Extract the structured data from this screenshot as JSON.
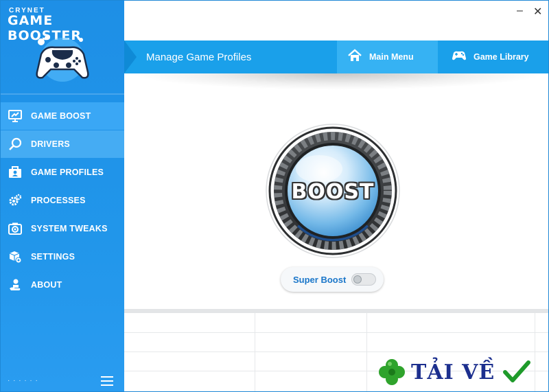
{
  "app": {
    "brand_top": "CRYNET",
    "brand_main": "GAME BOOSTER"
  },
  "sidebar": {
    "items": [
      {
        "label": "GAME BOOST",
        "icon": "monitor-boost-icon",
        "state": "active"
      },
      {
        "label": "DRIVERS",
        "icon": "search-icon",
        "state": "hover"
      },
      {
        "label": "GAME PROFILES",
        "icon": "profile-card-icon",
        "state": "normal"
      },
      {
        "label": "PROCESSES",
        "icon": "gears-icon",
        "state": "normal"
      },
      {
        "label": "SYSTEM TWEAKS",
        "icon": "camera-settings-icon",
        "state": "normal"
      },
      {
        "label": "SETTINGS",
        "icon": "box-settings-icon",
        "state": "normal"
      },
      {
        "label": "ABOUT",
        "icon": "hand-user-icon",
        "state": "normal"
      }
    ],
    "footer_text": "· · · · · ·"
  },
  "window_controls": {
    "minimize": "–",
    "close": "✕"
  },
  "header": {
    "title": "Manage Game Profiles",
    "main_menu_label": "Main Menu",
    "game_library_label": "Game Library"
  },
  "boost": {
    "label": "BOOST",
    "super_boost_label": "Super Boost",
    "super_boost_on": false
  },
  "watermark": {
    "text": "TẢI VỀ"
  },
  "colors": {
    "sidebar": "#2196ea",
    "header": "#1aa0ea",
    "accent_text": "#1a76c9",
    "check_green": "#1e9a2a",
    "clover_green": "#2fa32c"
  }
}
